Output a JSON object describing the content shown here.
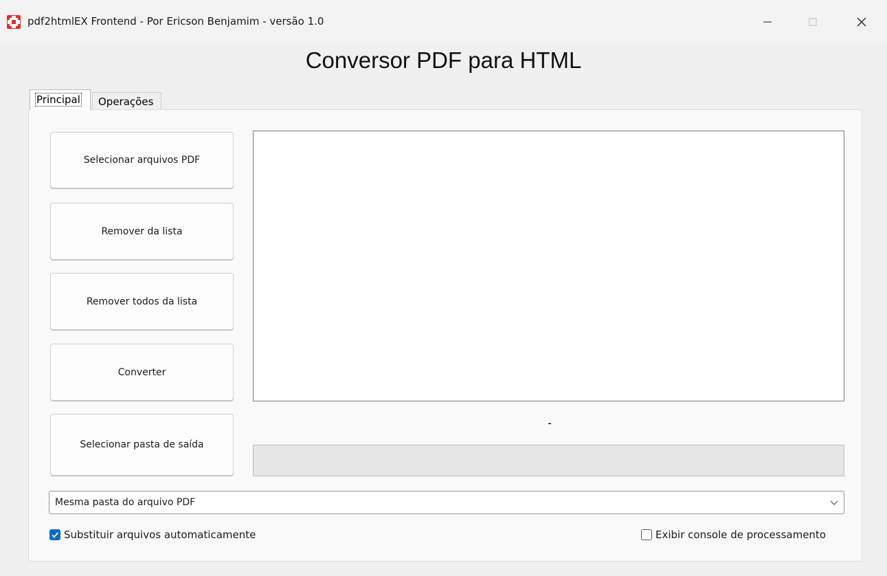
{
  "window": {
    "title": "pdf2htmlEX Frontend - Por Ericson Benjamim - versão 1.0",
    "icon": "app-icon",
    "controls": {
      "minimize": "minimize-icon",
      "maximize": "maximize-icon",
      "close": "close-icon"
    }
  },
  "header": {
    "title": "Conversor PDF para HTML"
  },
  "tabs": [
    {
      "label": "Principal",
      "active": true
    },
    {
      "label": "Operações",
      "active": false
    }
  ],
  "buttons": {
    "select_pdf": "Selecionar arquivos PDF",
    "remove": "Remover da lista",
    "remove_all": "Remover todos da lista",
    "convert": "Converter",
    "select_output": "Selecionar pasta de saída"
  },
  "file_list": {
    "items": []
  },
  "status": {
    "text": "-"
  },
  "progress": {
    "value": 0
  },
  "output_folder": {
    "selected": "Mesma pasta do arquivo PDF"
  },
  "options": {
    "auto_replace": {
      "label": "Substituir arquivos automaticamente",
      "checked": true
    },
    "show_console": {
      "label": "Exibir console de processamento",
      "checked": false
    }
  },
  "colors": {
    "accent": "#0f6cbd",
    "app_icon": "#d9302b"
  }
}
